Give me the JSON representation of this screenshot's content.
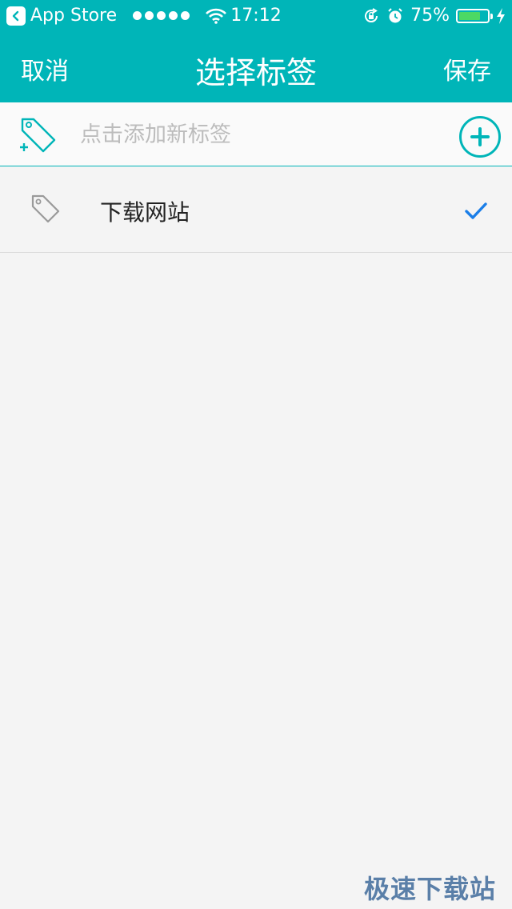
{
  "status_bar": {
    "back_app": "App Store",
    "time": "17:12",
    "battery_percent": "75%",
    "battery_level": 0.75,
    "signal_dots": 5
  },
  "nav": {
    "cancel": "取消",
    "title": "选择标签",
    "save": "保存"
  },
  "add_tag": {
    "placeholder": "点击添加新标签"
  },
  "tags": [
    {
      "label": "下载网站",
      "selected": true
    }
  ],
  "watermark": "极速下载站",
  "colors": {
    "accent": "#00b5b8",
    "check": "#1a7ee8",
    "background": "#f4f4f4"
  }
}
